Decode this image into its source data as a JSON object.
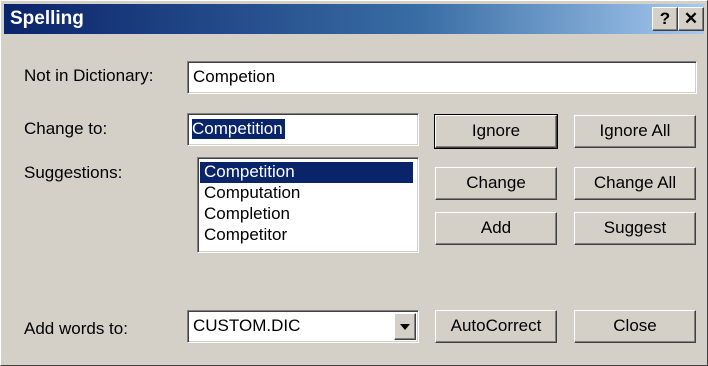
{
  "window": {
    "title": "Spelling",
    "help_label": "?",
    "close_label": "✕"
  },
  "labels": {
    "not_in_dictionary": "Not in Dictionary:",
    "change_to": "Change to:",
    "suggestions": "Suggestions:",
    "add_words_to": "Add words to:"
  },
  "fields": {
    "not_in_dictionary_value": "Competion",
    "change_to_value": "Competition",
    "add_words_to_value": "CUSTOM.DIC"
  },
  "suggestions": [
    "Competition",
    "Computation",
    "Completion",
    "Competitor"
  ],
  "buttons": {
    "ignore": "Ignore",
    "ignore_all": "Ignore All",
    "change": "Change",
    "change_all": "Change All",
    "add": "Add",
    "suggest": "Suggest",
    "autocorrect": "AutoCorrect",
    "close": "Close"
  }
}
